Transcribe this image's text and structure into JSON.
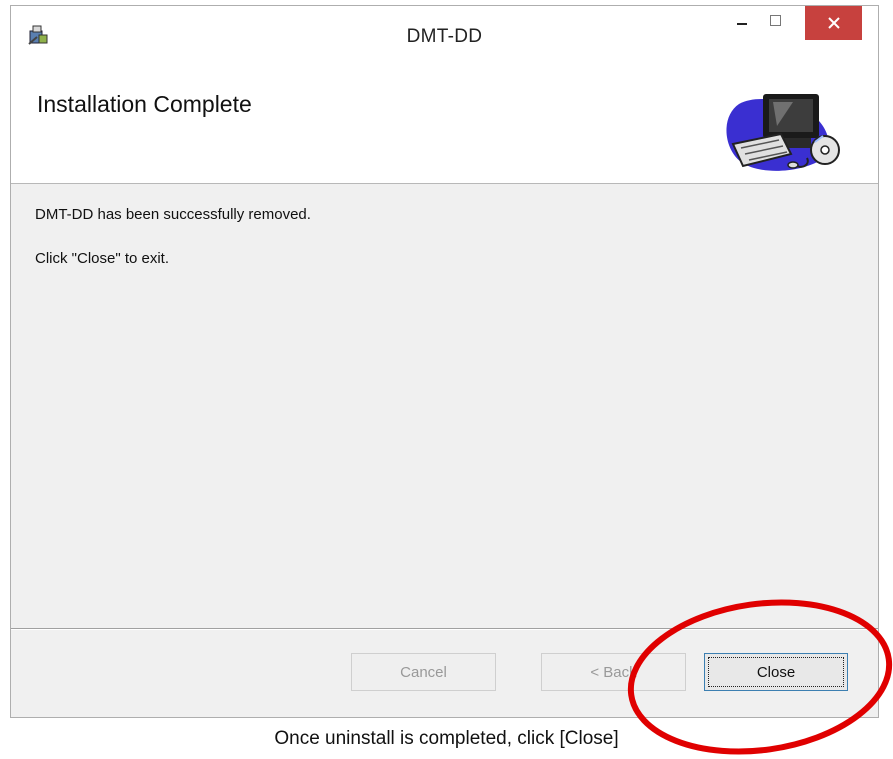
{
  "window": {
    "title": "DMT-DD",
    "controls": {
      "minimize": "−",
      "maximize": "☐",
      "close": "✕"
    },
    "app_icon": "installer-icon"
  },
  "header": {
    "title": "Installation Complete",
    "banner_icon": "computer-cd-icon"
  },
  "body": {
    "line1": "DMT-DD has been successfully removed.",
    "line2": "Click \"Close\" to exit."
  },
  "buttons": {
    "cancel": "Cancel",
    "back": "< Back",
    "close": "Close"
  },
  "caption": "Once uninstall is completed, click [Close]",
  "colors": {
    "close_button_bg": "#c7413e",
    "annotation_circle": "#e00000",
    "focus_border": "#3c7fb1"
  }
}
